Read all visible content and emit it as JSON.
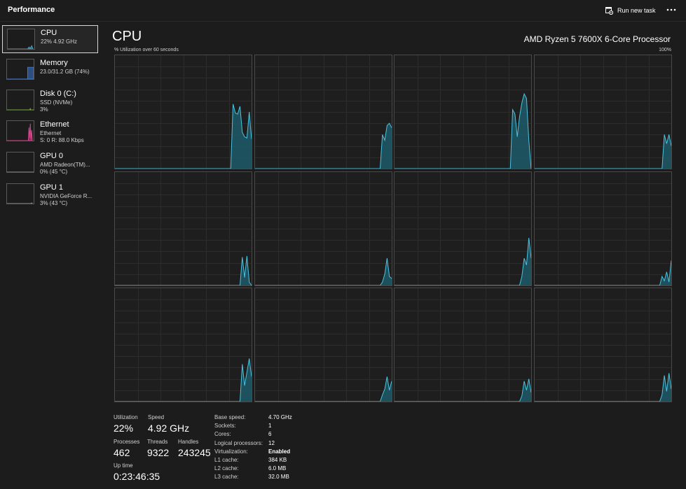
{
  "header": {
    "title": "Performance",
    "run_task_label": "Run new task",
    "more_icon": "ellipsis-icon",
    "run_task_icon": "run-task-icon"
  },
  "sidebar": {
    "items": [
      {
        "name": "CPU",
        "line1": "22%  4.92 GHz",
        "line2": "",
        "color": "#3fa7c6",
        "selected": true
      },
      {
        "name": "Memory",
        "line1": "23.0/31.2 GB (74%)",
        "line2": "",
        "color": "#3a78d6",
        "selected": false
      },
      {
        "name": "Disk 0 (C:)",
        "line1": "SSD (NVMe)",
        "line2": "3%",
        "color": "#6aa832",
        "selected": false
      },
      {
        "name": "Ethernet",
        "line1": "Ethernet",
        "line2": "S: 0  R: 88.0 Kbps",
        "color": "#d9448d",
        "selected": false
      },
      {
        "name": "GPU 0",
        "line1": "AMD Radeon(TM)...",
        "line2": "0%  (45 °C)",
        "color": "#9a9a9a",
        "selected": false
      },
      {
        "name": "GPU 1",
        "line1": "NVIDIA GeForce R...",
        "line2": "3%  (43 °C)",
        "color": "#9a9a9a",
        "selected": false
      }
    ]
  },
  "main": {
    "title": "CPU",
    "processor": "AMD Ryzen 5 7600X 6-Core Processor",
    "util_label": "% Utilization over 60 seconds",
    "util_max": "100%"
  },
  "chart_data": {
    "type": "area",
    "title": "% Utilization over 60 seconds",
    "ylim": [
      0,
      100
    ],
    "line_color": "#4cc3e0",
    "fill_color": "#1d5a6a",
    "grid": true,
    "series": [
      {
        "values": [
          0,
          0,
          0,
          0,
          0,
          0,
          0,
          0,
          0,
          0,
          0,
          0,
          0,
          0,
          0,
          0,
          0,
          0,
          0,
          0,
          0,
          0,
          0,
          0,
          0,
          0,
          0,
          0,
          0,
          0,
          0,
          0,
          0,
          0,
          0,
          0,
          0,
          0,
          0,
          0,
          0,
          0,
          0,
          0,
          0,
          0,
          0,
          0,
          0,
          0,
          0,
          57,
          49,
          48,
          55,
          32,
          28,
          27,
          50,
          26
        ]
      },
      {
        "values": [
          0,
          0,
          0,
          0,
          0,
          0,
          0,
          0,
          0,
          0,
          0,
          0,
          0,
          0,
          0,
          0,
          0,
          0,
          0,
          0,
          0,
          0,
          0,
          0,
          0,
          0,
          0,
          0,
          0,
          0,
          0,
          0,
          0,
          0,
          0,
          0,
          0,
          0,
          0,
          0,
          0,
          0,
          0,
          0,
          0,
          0,
          0,
          0,
          0,
          0,
          0,
          0,
          0,
          0,
          0,
          30,
          25,
          38,
          40,
          36
        ]
      },
      {
        "values": [
          0,
          0,
          0,
          0,
          0,
          0,
          0,
          0,
          0,
          0,
          0,
          0,
          0,
          0,
          0,
          0,
          0,
          0,
          0,
          0,
          0,
          0,
          0,
          0,
          0,
          0,
          0,
          0,
          0,
          0,
          0,
          0,
          0,
          0,
          0,
          0,
          0,
          0,
          0,
          0,
          0,
          0,
          0,
          0,
          0,
          0,
          0,
          0,
          0,
          0,
          0,
          52,
          48,
          28,
          46,
          58,
          66,
          62,
          25,
          0
        ]
      },
      {
        "values": [
          0,
          0,
          0,
          0,
          0,
          0,
          0,
          0,
          0,
          0,
          0,
          0,
          0,
          0,
          0,
          0,
          0,
          0,
          0,
          0,
          0,
          0,
          0,
          0,
          0,
          0,
          0,
          0,
          0,
          0,
          0,
          0,
          0,
          0,
          0,
          0,
          0,
          0,
          0,
          0,
          0,
          0,
          0,
          0,
          0,
          0,
          0,
          0,
          0,
          0,
          0,
          0,
          0,
          0,
          0,
          0,
          30,
          22,
          30,
          20
        ]
      },
      {
        "values": [
          0,
          0,
          0,
          0,
          0,
          0,
          0,
          0,
          0,
          0,
          0,
          0,
          0,
          0,
          0,
          0,
          0,
          0,
          0,
          0,
          0,
          0,
          0,
          0,
          0,
          0,
          0,
          0,
          0,
          0,
          0,
          0,
          0,
          0,
          0,
          0,
          0,
          0,
          0,
          0,
          0,
          0,
          0,
          0,
          0,
          0,
          0,
          0,
          0,
          0,
          0,
          0,
          0,
          0,
          0,
          25,
          7,
          26,
          3,
          0
        ]
      },
      {
        "values": [
          0,
          0,
          0,
          0,
          0,
          0,
          0,
          0,
          0,
          0,
          0,
          0,
          0,
          0,
          0,
          0,
          0,
          0,
          0,
          0,
          0,
          0,
          0,
          0,
          0,
          0,
          0,
          0,
          0,
          0,
          0,
          0,
          0,
          0,
          0,
          0,
          0,
          0,
          0,
          0,
          0,
          0,
          0,
          0,
          0,
          0,
          0,
          0,
          0,
          0,
          0,
          0,
          0,
          0,
          0,
          3,
          10,
          24,
          8,
          6
        ]
      },
      {
        "values": [
          0,
          0,
          0,
          0,
          0,
          0,
          0,
          0,
          0,
          0,
          0,
          0,
          0,
          0,
          0,
          0,
          0,
          0,
          0,
          0,
          0,
          0,
          0,
          0,
          0,
          0,
          0,
          0,
          0,
          0,
          0,
          0,
          0,
          0,
          0,
          0,
          0,
          0,
          0,
          0,
          0,
          0,
          0,
          0,
          0,
          0,
          0,
          0,
          0,
          0,
          0,
          0,
          0,
          0,
          0,
          8,
          24,
          18,
          42,
          24
        ]
      },
      {
        "values": [
          0,
          0,
          0,
          0,
          0,
          0,
          0,
          0,
          0,
          0,
          0,
          0,
          0,
          0,
          0,
          0,
          0,
          0,
          0,
          0,
          0,
          0,
          0,
          0,
          0,
          0,
          0,
          0,
          0,
          0,
          0,
          0,
          0,
          0,
          0,
          0,
          0,
          0,
          0,
          0,
          0,
          0,
          0,
          0,
          0,
          0,
          0,
          0,
          0,
          0,
          0,
          0,
          0,
          0,
          0,
          8,
          4,
          12,
          3,
          22
        ]
      },
      {
        "values": [
          0,
          0,
          0,
          0,
          0,
          0,
          0,
          0,
          0,
          0,
          0,
          0,
          0,
          0,
          0,
          0,
          0,
          0,
          0,
          0,
          0,
          0,
          0,
          0,
          0,
          0,
          0,
          0,
          0,
          0,
          0,
          0,
          0,
          0,
          0,
          0,
          0,
          0,
          0,
          0,
          0,
          0,
          0,
          0,
          0,
          0,
          0,
          0,
          0,
          0,
          0,
          0,
          0,
          0,
          0,
          33,
          14,
          26,
          38,
          22
        ]
      },
      {
        "values": [
          0,
          0,
          0,
          0,
          0,
          0,
          0,
          0,
          0,
          0,
          0,
          0,
          0,
          0,
          0,
          0,
          0,
          0,
          0,
          0,
          0,
          0,
          0,
          0,
          0,
          0,
          0,
          0,
          0,
          0,
          0,
          0,
          0,
          0,
          0,
          0,
          0,
          0,
          0,
          0,
          0,
          0,
          0,
          0,
          0,
          0,
          0,
          0,
          0,
          0,
          0,
          0,
          0,
          0,
          0,
          6,
          11,
          22,
          10,
          18
        ]
      },
      {
        "values": [
          0,
          0,
          0,
          0,
          0,
          0,
          0,
          0,
          0,
          0,
          0,
          0,
          0,
          0,
          0,
          0,
          0,
          0,
          0,
          0,
          0,
          0,
          0,
          0,
          0,
          0,
          0,
          0,
          0,
          0,
          0,
          0,
          0,
          0,
          0,
          0,
          0,
          0,
          0,
          0,
          0,
          0,
          0,
          0,
          0,
          0,
          0,
          0,
          0,
          0,
          0,
          0,
          0,
          0,
          0,
          5,
          18,
          10,
          20,
          8
        ]
      },
      {
        "values": [
          0,
          0,
          0,
          0,
          0,
          0,
          0,
          0,
          0,
          0,
          0,
          0,
          0,
          0,
          0,
          0,
          0,
          0,
          0,
          0,
          0,
          0,
          0,
          0,
          0,
          0,
          0,
          0,
          0,
          0,
          0,
          0,
          0,
          0,
          0,
          0,
          0,
          0,
          0,
          0,
          0,
          0,
          0,
          0,
          0,
          0,
          0,
          0,
          0,
          0,
          0,
          0,
          0,
          0,
          0,
          6,
          23,
          9,
          25,
          11
        ]
      }
    ]
  },
  "stats": {
    "utilization": {
      "label": "Utilization",
      "value": "22%"
    },
    "speed": {
      "label": "Speed",
      "value": "4.92 GHz"
    },
    "processes": {
      "label": "Processes",
      "value": "462"
    },
    "threads": {
      "label": "Threads",
      "value": "9322"
    },
    "handles": {
      "label": "Handles",
      "value": "243245"
    },
    "uptime": {
      "label": "Up time",
      "value": "0:23:46:35"
    },
    "details": [
      {
        "key": "Base speed:",
        "value": "4.70 GHz"
      },
      {
        "key": "Sockets:",
        "value": "1"
      },
      {
        "key": "Cores:",
        "value": "6"
      },
      {
        "key": "Logical processors:",
        "value": "12"
      },
      {
        "key": "Virtualization:",
        "value": "Enabled"
      },
      {
        "key": "L1 cache:",
        "value": "384 KB"
      },
      {
        "key": "L2 cache:",
        "value": "6.0 MB"
      },
      {
        "key": "L3 cache:",
        "value": "32.0 MB"
      }
    ]
  }
}
